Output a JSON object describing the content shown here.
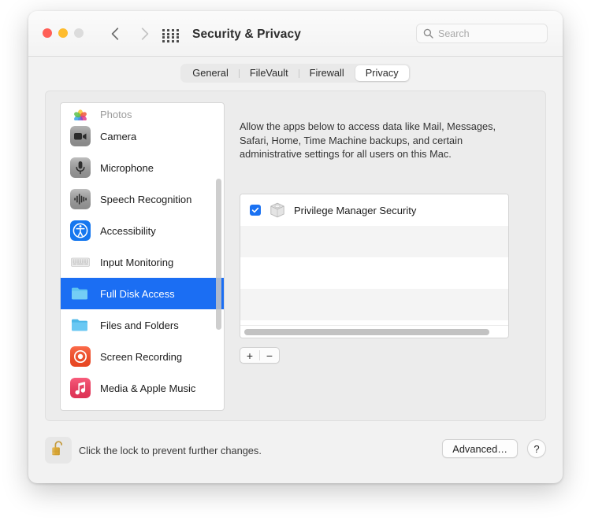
{
  "window": {
    "title": "Security & Privacy",
    "traffic_lights": [
      "close",
      "minimize",
      "zoom"
    ],
    "nav_back": "‹",
    "nav_forward": "›"
  },
  "search": {
    "placeholder": "Search",
    "value": ""
  },
  "tabs": [
    {
      "label": "General",
      "selected": false
    },
    {
      "label": "FileVault",
      "selected": false
    },
    {
      "label": "Firewall",
      "selected": false
    },
    {
      "label": "Privacy",
      "selected": true
    }
  ],
  "sidebar": {
    "items": [
      {
        "label": "Photos",
        "icon": "photos-icon",
        "selected": false,
        "partial": true
      },
      {
        "label": "Camera",
        "icon": "camera-icon",
        "selected": false
      },
      {
        "label": "Microphone",
        "icon": "microphone-icon",
        "selected": false
      },
      {
        "label": "Speech Recognition",
        "icon": "speech-recognition-icon",
        "selected": false
      },
      {
        "label": "Accessibility",
        "icon": "accessibility-icon",
        "selected": false
      },
      {
        "label": "Input Monitoring",
        "icon": "keyboard-icon",
        "selected": false
      },
      {
        "label": "Full Disk Access",
        "icon": "folder-icon",
        "selected": true
      },
      {
        "label": "Files and Folders",
        "icon": "folder-icon",
        "selected": false
      },
      {
        "label": "Screen Recording",
        "icon": "screen-recording-icon",
        "selected": false
      },
      {
        "label": "Media & Apple Music",
        "icon": "music-note-icon",
        "selected": false
      }
    ],
    "selection_color": "#1b6ef3"
  },
  "main": {
    "description": "Allow the apps below to access data like Mail, Messages, Safari, Home, Time Machine backups, and certain administrative settings for all users on this Mac.",
    "apps": [
      {
        "name": "Privilege Manager Security",
        "checked": true,
        "icon": "app-cube-icon"
      }
    ],
    "empty_rows": 3,
    "add_label": "+",
    "remove_label": "−"
  },
  "footer": {
    "lock_icon": "unlocked-padlock-icon",
    "lock_caption": "Click the lock to prevent further changes.",
    "advanced_label": "Advanced…",
    "help_label": "?"
  },
  "colors": {
    "accent": "#1b6ef3",
    "checkbox": "#1b72f2",
    "window_bg": "#f2f2f2",
    "panel_bg": "#ececec"
  }
}
